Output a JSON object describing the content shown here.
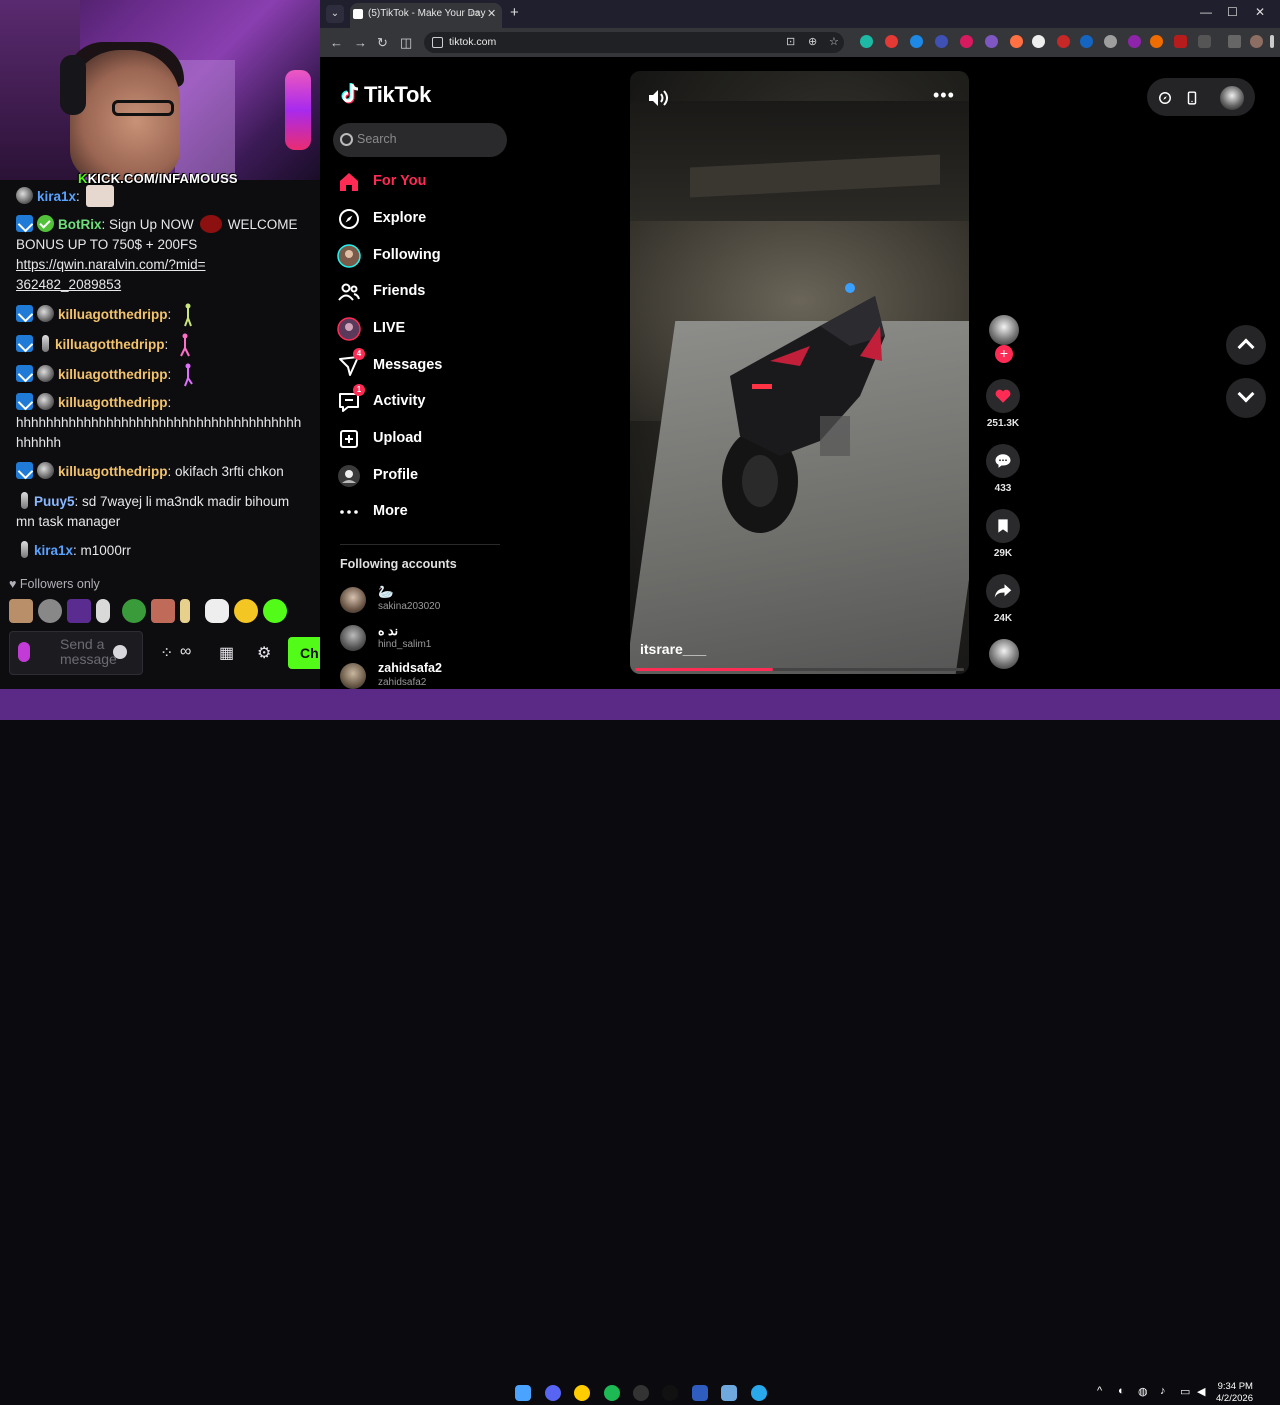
{
  "stream": {
    "kick_banner": "KICK.COM/INFAMOUSS",
    "chat": [
      {
        "user": "kira1x",
        "text": ":"
      },
      {
        "user": "BotRix",
        "text": ": Sign Up NOW",
        "text2": "WELCOME BONUS UP TO 750$ + 200FS",
        "link": "https://qwin.naralvin.com/?mid=362482_2089853"
      },
      {
        "user": "killuagotthedripp",
        "text": ":"
      },
      {
        "user": "killuagotthedripp",
        "text": ":"
      },
      {
        "user": "killuagotthedripp",
        "text": ":"
      },
      {
        "user": "killuagotthedripp",
        "text": ":",
        "text2": "hhhhhhhhhhhhhhhhhhhhhhhhhhhhhhhhhhhhhhhhhhhh"
      },
      {
        "user": "killuagotthedripp",
        "text": ": okifach 3rfti chkon"
      },
      {
        "user": "Puuy5",
        "text": ": sd 7wayej li ma3ndk madir bihoum mn task manager"
      },
      {
        "user": "kira1x",
        "text": ": m1000rr"
      }
    ],
    "followers_only": "Followers only",
    "input_placeholder": "Send a message",
    "send_label": "Ch"
  },
  "browser": {
    "tab_title": "(5)TikTok - Make Your Day",
    "url": "tiktok.com"
  },
  "tiktok": {
    "logo": "TikTok",
    "search_placeholder": "Search",
    "nav": [
      {
        "label": "For You",
        "icon": "home-icon"
      },
      {
        "label": "Explore",
        "icon": "compass-icon"
      },
      {
        "label": "Following",
        "icon": "following-avatar-icon"
      },
      {
        "label": "Friends",
        "icon": "friends-icon"
      },
      {
        "label": "LIVE",
        "icon": "live-icon"
      },
      {
        "label": "Messages",
        "icon": "messages-icon",
        "badge": "4"
      },
      {
        "label": "Activity",
        "icon": "activity-icon",
        "badge": "1"
      },
      {
        "label": "Upload",
        "icon": "upload-icon"
      },
      {
        "label": "Profile",
        "icon": "profile-icon"
      },
      {
        "label": "More",
        "icon": "more-icon"
      }
    ],
    "following_title": "Following accounts",
    "following": [
      {
        "name": "🦢",
        "handle": "sakina203020"
      },
      {
        "name": "ند ه",
        "handle": "hind_salim1"
      },
      {
        "name": "zahidsafa2",
        "handle": "zahidsafa2"
      }
    ],
    "video": {
      "author": "itsrare___",
      "progress": 0.42
    },
    "actions": {
      "likes": "251.3K",
      "comments": "433",
      "saves": "29K",
      "shares": "24K"
    },
    "accent": "#fe2c55"
  },
  "taskbar": {
    "time": "9:34 PM",
    "date": "4/2/2026"
  }
}
